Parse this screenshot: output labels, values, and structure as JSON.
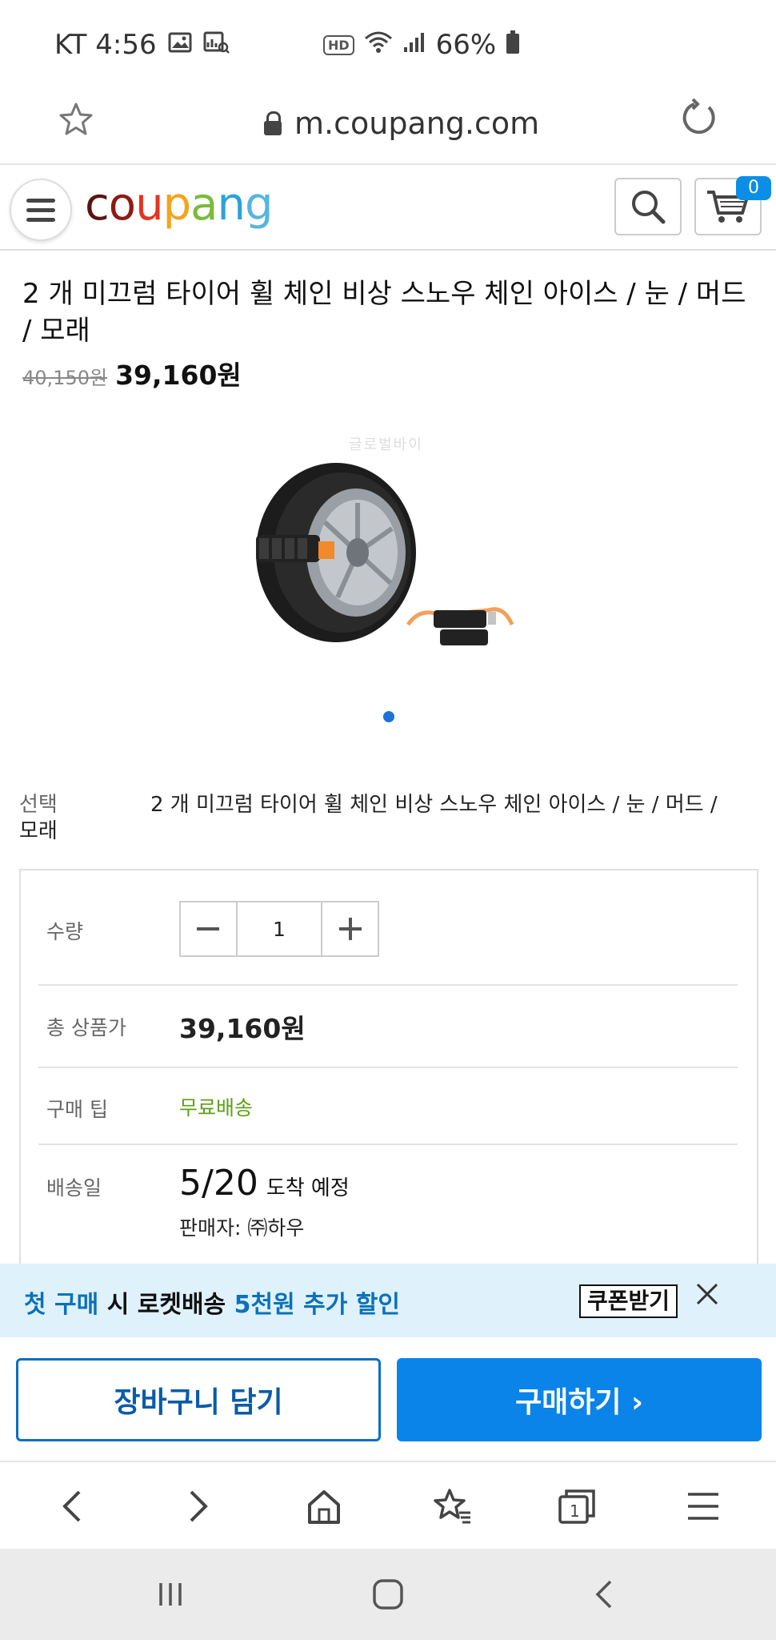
{
  "status_bar": {
    "carrier_time": "KT 4:56",
    "battery": "66%",
    "hd_label": "HD"
  },
  "browser": {
    "url": "m.coupang.com"
  },
  "header": {
    "logo_parts": [
      "c",
      "o",
      "u",
      "p",
      "a",
      "n",
      "g"
    ],
    "cart_count": "0"
  },
  "product": {
    "title": "2 개 미끄럼 타이어 휠 체인 비상 스노우 체인 아이스 / 눈 / 머드 / 모래",
    "original_price": "40,150원",
    "sale_price": "39,160원",
    "watermark": "글로벌바이"
  },
  "option": {
    "label": "선택",
    "value": "2 개 미끄럼 타이어 휠 체인 비상 스노우 체인 아이스 / 눈 / 머드 /",
    "value_wrap": "모래"
  },
  "details": {
    "quantity_label": "수량",
    "quantity": "1",
    "total_label": "총 상품가",
    "total_price": "39,160원",
    "tip_label": "구매 팁",
    "tip_value": "무료배송",
    "delivery_label": "배송일",
    "delivery_date": "5/20",
    "delivery_suffix": "도착 예정",
    "seller": "판매자: ㈜하우"
  },
  "coupon": {
    "text_blue1": "첫 구매",
    "text_black1": " 시 로켓배송 ",
    "text_blue2": "5천원 추가 할인",
    "button": "쿠폰받기"
  },
  "actions": {
    "add_to_cart": "장바구니 담기",
    "buy_now": "구매하기 ›"
  },
  "colors": {
    "accent_blue": "#0a84e8",
    "free_shipping_green": "#5ea016",
    "banner_bg": "#dff1fb"
  }
}
